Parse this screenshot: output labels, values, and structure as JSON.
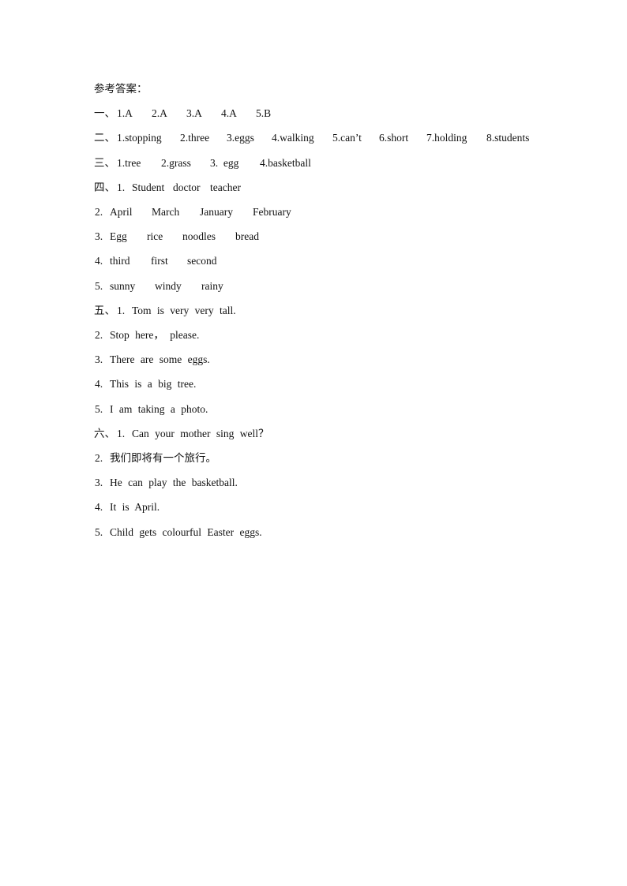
{
  "title": "参考答案：",
  "sections": [
    {
      "prefix": "一、",
      "items": [
        "1.A",
        "2.A",
        "3.A",
        "4.A",
        "5.B"
      ]
    },
    {
      "prefix": "二、",
      "items": [
        "1.stopping",
        "2.three",
        "3.eggs",
        "4.walking",
        "5.can’t",
        "6.short",
        "7.holding",
        "8.students"
      ]
    },
    {
      "prefix": "三、",
      "items": [
        "1.tree",
        "2.grass",
        "3.  egg",
        "4.basketball"
      ]
    },
    {
      "prefix": "四、",
      "rows": [
        {
          "num": "1.",
          "words": [
            "Student",
            "doctor",
            "teacher"
          ]
        },
        {
          "num": "2.",
          "words": [
            "April",
            "March",
            "January",
            "February"
          ]
        },
        {
          "num": "3.",
          "words": [
            "Egg",
            "rice",
            "noodles",
            "bread"
          ]
        },
        {
          "num": "4.",
          "words": [
            "third",
            "first",
            "second"
          ]
        },
        {
          "num": "5.",
          "words": [
            "sunny",
            "windy",
            "rainy"
          ]
        }
      ]
    },
    {
      "prefix": "五、",
      "rows": [
        {
          "num": "1.",
          "text": "Tom is very very tall."
        },
        {
          "num": "2.",
          "text": "Stop here， please."
        },
        {
          "num": "3.",
          "text": "There are some eggs."
        },
        {
          "num": "4.",
          "text": "This is a big tree."
        },
        {
          "num": "5.",
          "text": "I am taking a photo."
        }
      ]
    },
    {
      "prefix": "六、",
      "rows": [
        {
          "num": "1.",
          "text": "Can your mother sing well？"
        },
        {
          "num": "2.",
          "text": "我们即将有一个旅行。"
        },
        {
          "num": "3.",
          "text": "He can play the basketball."
        },
        {
          "num": "4.",
          "text": "It is April."
        },
        {
          "num": "5.",
          "text": "Child gets colourful Easter eggs."
        }
      ]
    }
  ]
}
